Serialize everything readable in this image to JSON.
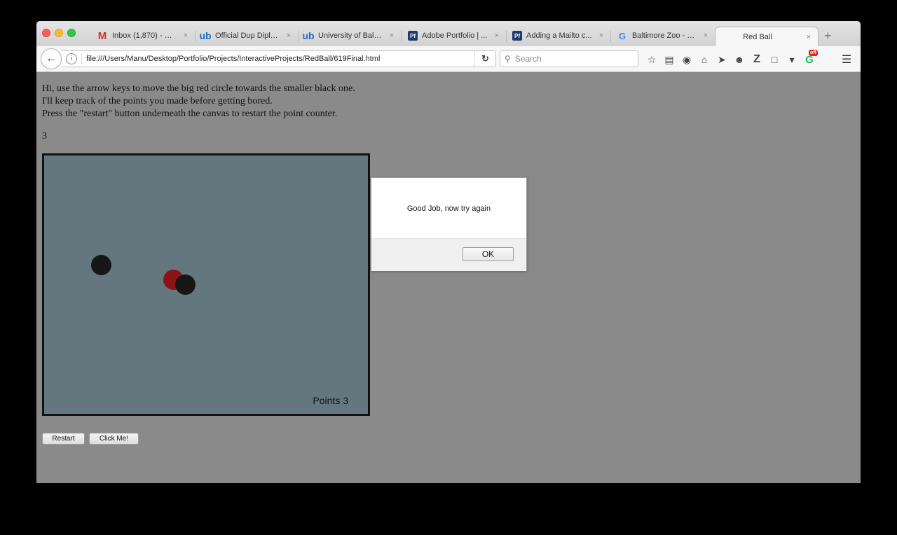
{
  "tabs": [
    {
      "label": "Inbox (1,870) - ma...",
      "icon": "gmail-icon",
      "glyph": "M"
    },
    {
      "label": "Official Dup Diplo...",
      "icon": "ub-icon",
      "glyph": "ub"
    },
    {
      "label": "University of Balti...",
      "icon": "ub-icon",
      "glyph": "ub"
    },
    {
      "label": "Adobe Portfolio | ...",
      "icon": "pf-icon",
      "glyph": "Pf"
    },
    {
      "label": "Adding a Mailto c...",
      "icon": "pf-icon",
      "glyph": "Pf"
    },
    {
      "label": "Baltimore Zoo - G...",
      "icon": "google-icon",
      "glyph": "G"
    },
    {
      "label": "Red Ball",
      "icon": "",
      "glyph": ""
    }
  ],
  "tab_close_glyph": "×",
  "new_tab_glyph": "+",
  "nav": {
    "url": "file:///Users/Manu/Desktop/Portfolio/Projects/InteractiveProjects/RedBall/619Final.html",
    "search_placeholder": "Search",
    "grammarly_badge": "off"
  },
  "page": {
    "intro_lines": [
      "Hi, use the arrow keys to move the big red circle towards the smaller black one.",
      "I'll keep track of the points you made before getting bored.",
      "Press the \"restart\" button underneath the canvas to restart the point counter."
    ],
    "score": "3",
    "canvas_points_label": "Points 3",
    "restart_label": "Restart",
    "clickme_label": "Click Me!"
  },
  "dialog": {
    "message": "Good Job, now try again",
    "ok_label": "OK"
  },
  "colors": {
    "canvas_bg": "#65777e",
    "red_ball": "#8a1414",
    "black_ball": "#161616",
    "page_bg": "#8a8a8a"
  }
}
